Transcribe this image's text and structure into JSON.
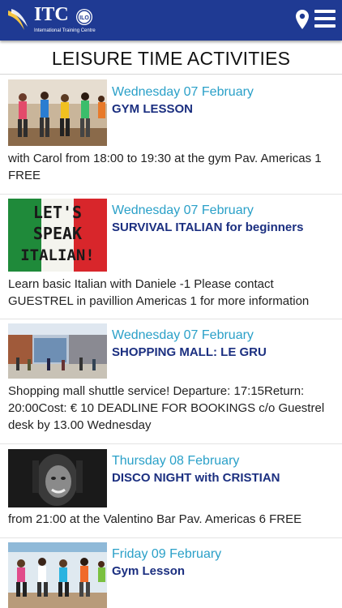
{
  "header": {
    "logo_text": "ITC",
    "logo_subtitle": "International Training Centre",
    "icons": [
      "map-pin-icon",
      "hamburger-menu-icon"
    ],
    "bar_color": "#1f3a93"
  },
  "page": {
    "title": "LEISURE TIME ACTIVITIES"
  },
  "events": [
    {
      "date": "Wednesday 07 February",
      "title": "GYM LESSON",
      "description": "with Carol from 18:00 to 19:30 at the gym Pav. Americas 1 FREE",
      "image": "gym-class-photo"
    },
    {
      "date": "Wednesday 07 February",
      "title": "SURVIVAL ITALIAN for beginners",
      "description": "Learn basic Italian with Daniele -1 Please contact GUESTREL in pavillion Americas 1  for more information",
      "image": "lets-speak-italian-sign",
      "image_text": [
        "LET'S",
        "SPEAK",
        "ITALIAN!"
      ]
    },
    {
      "date": "Wednesday 07 February",
      "title": "SHOPPING MALL: LE GRU",
      "description": "Shopping mall shuttle service! Departure: 17:15Return: 20:00Cost: € 10 DEADLINE FOR BOOKINGS c/o Guestrel desk  by 13.00 Wednesday",
      "image": "shopping-mall-photo"
    },
    {
      "date": "Thursday 08 February",
      "title": "DISCO NIGHT with CRISTIAN",
      "description": "from 21:00  at the Valentino Bar Pav. Americas 6 FREE",
      "image": "dj-portrait-photo"
    },
    {
      "date": "Friday 09 February",
      "title": "Gym Lesson",
      "description": "",
      "image": "aerobics-class-photo"
    }
  ],
  "colors": {
    "date": "#2aa0c8",
    "title": "#1b2f80"
  }
}
